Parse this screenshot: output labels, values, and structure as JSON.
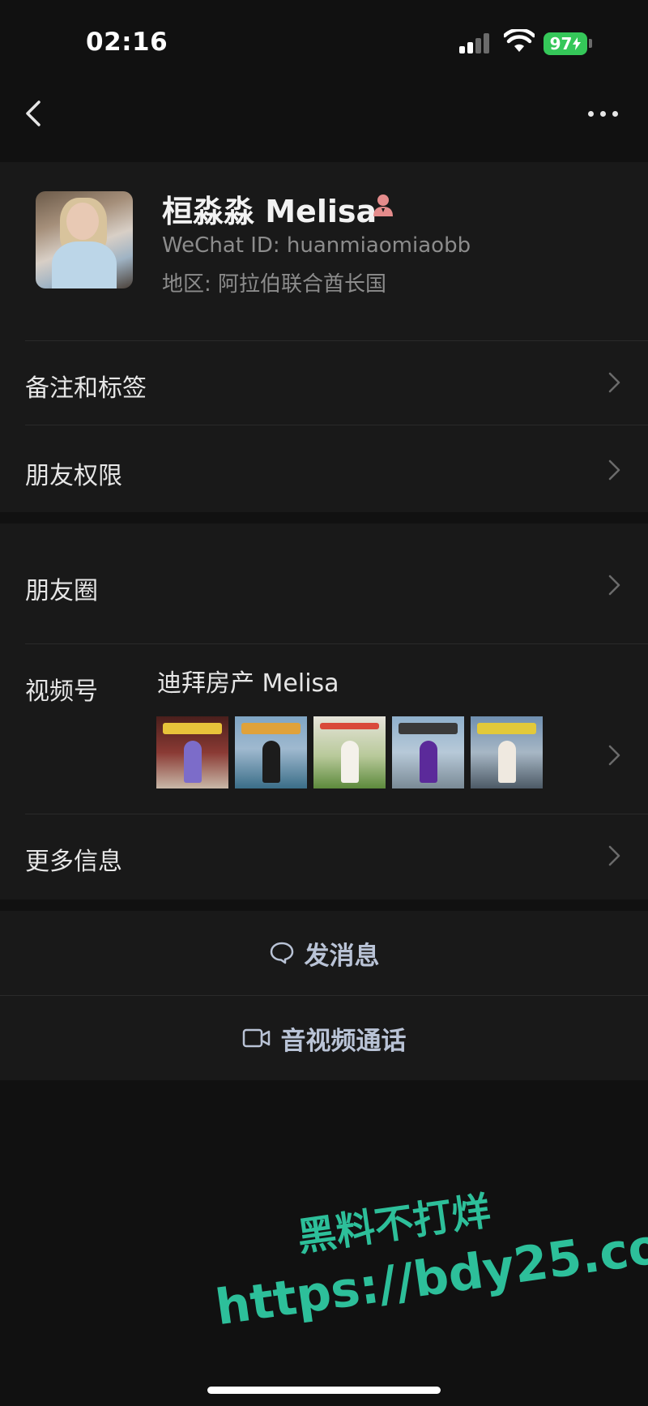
{
  "status_bar": {
    "time": "02:16",
    "battery": "97",
    "battery_color": "#35c759"
  },
  "nav": {
    "back_icon": "chevron-left-icon",
    "more_icon": "ellipsis-icon"
  },
  "profile": {
    "name": "桓淼淼 Melisa",
    "gender_icon": "female-icon",
    "wechat_id": "WeChat ID: huanmiaomiaobb",
    "region": "地区: 阿拉伯联合酋长国"
  },
  "rows": {
    "remarks_tags": "备注和标签",
    "friend_permissions": "朋友权限",
    "moments": "朋友圈",
    "channels": "视频号",
    "channels_name": "迪拜房产 Melisa",
    "more_info": "更多信息"
  },
  "actions": {
    "send_message": "发消息",
    "voice_video_call": "音视频通话",
    "accent_color": "#b9c3d6"
  },
  "watermark": {
    "line1": "黑料不打烊",
    "line2": "https://bdy25.co",
    "color": "#2dbf9a"
  }
}
